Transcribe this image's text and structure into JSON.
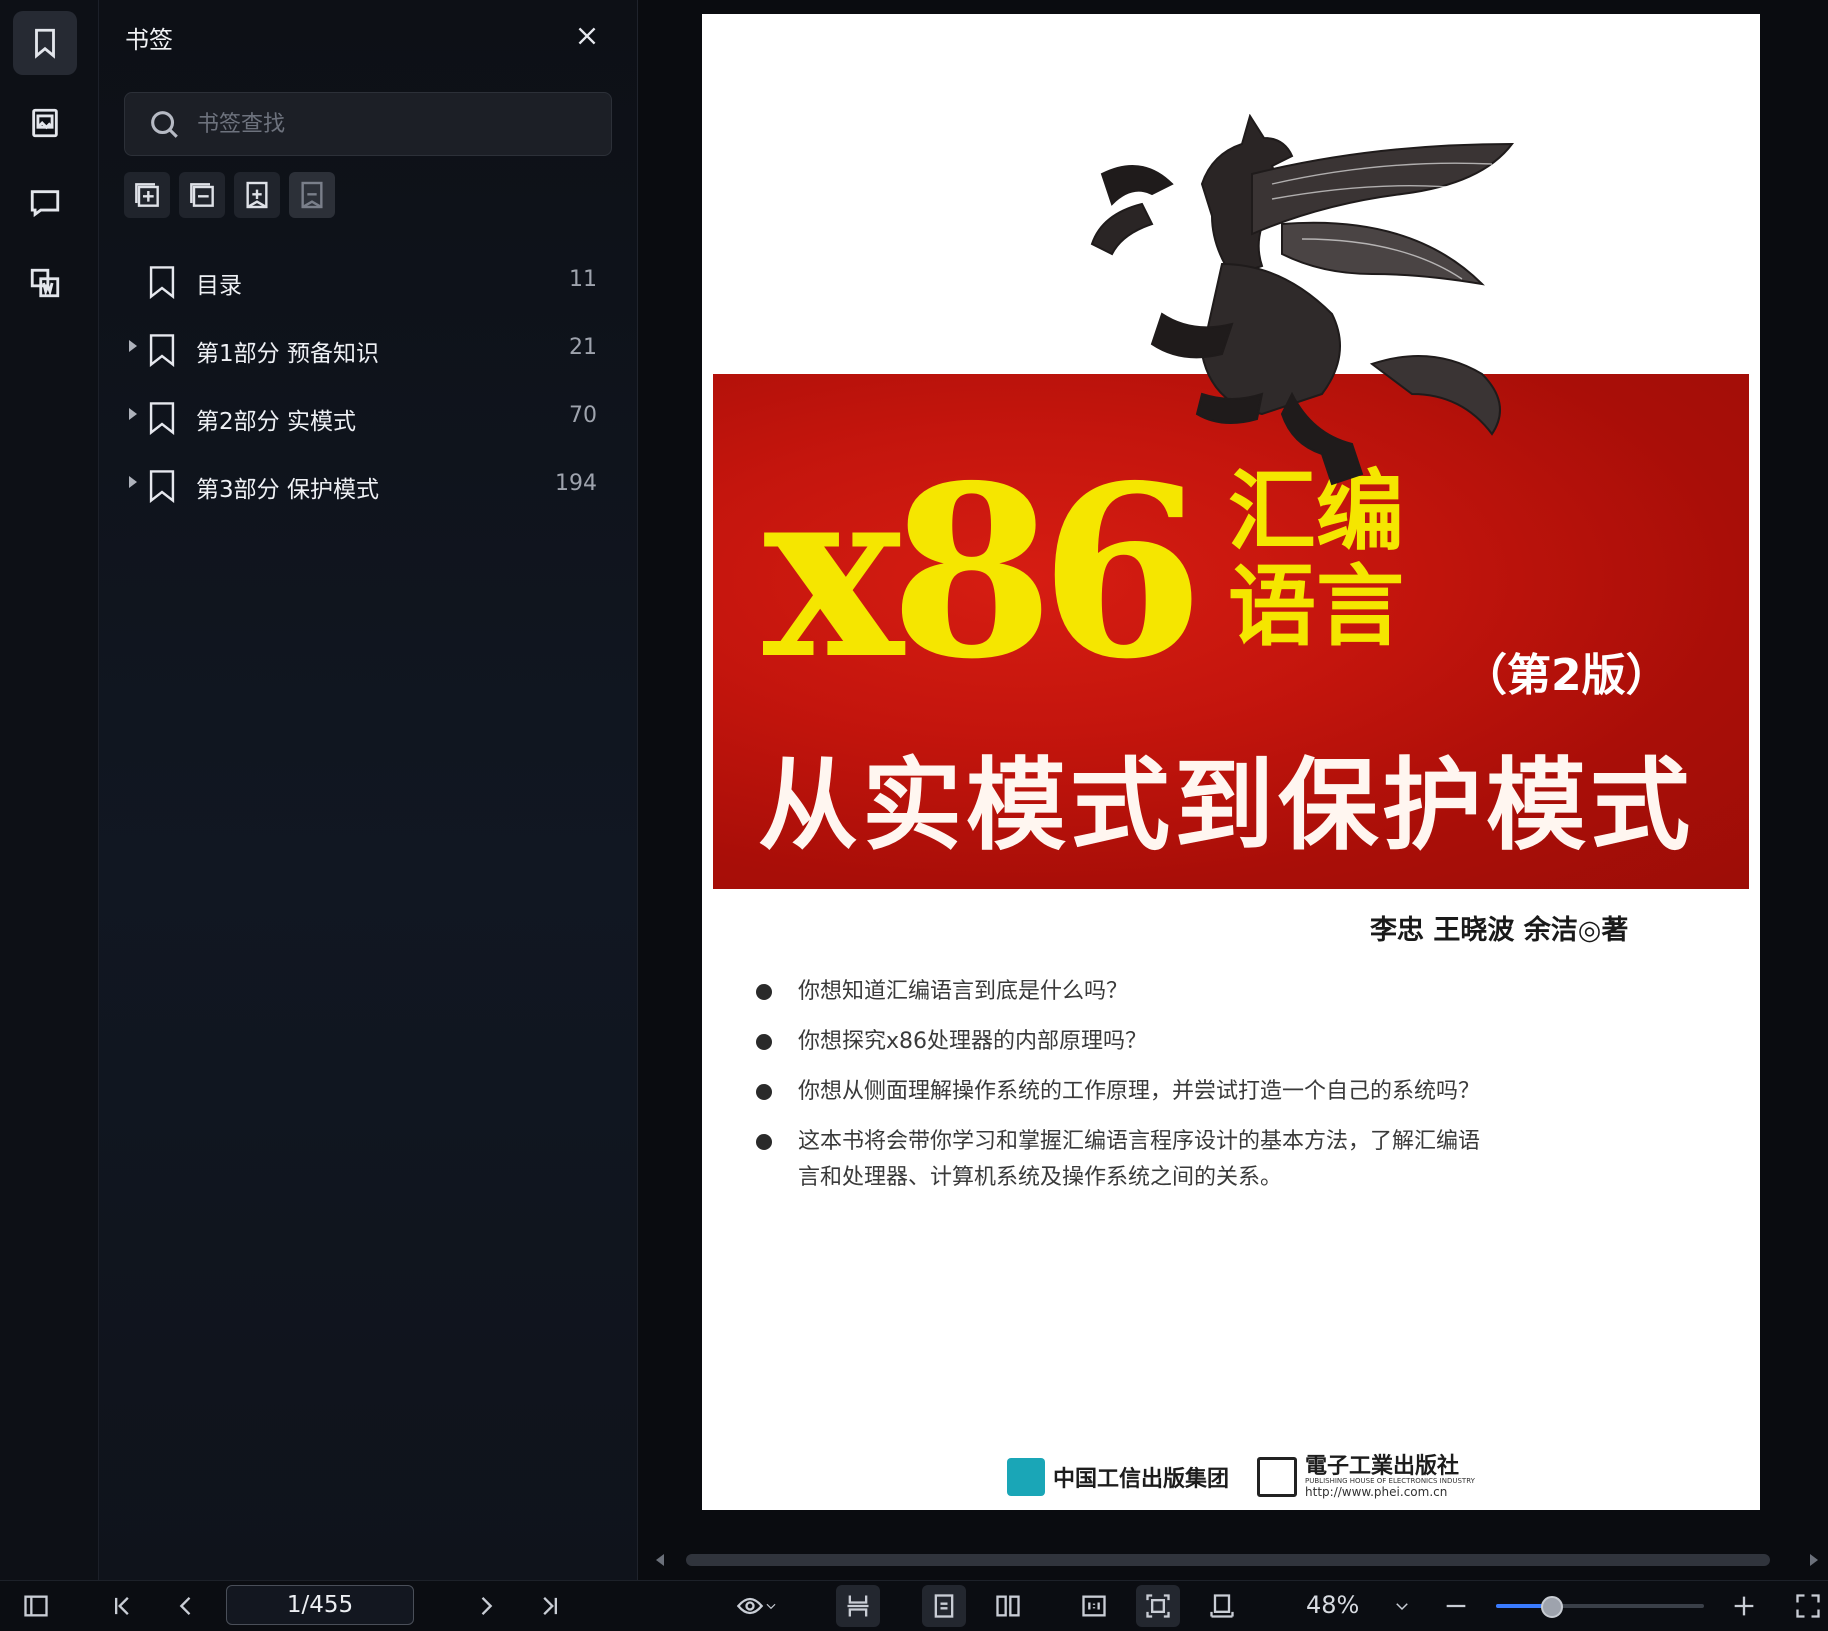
{
  "sidebar_rail": {
    "items": [
      {
        "name": "bookmark",
        "active": true
      },
      {
        "name": "thumbnails",
        "active": false
      },
      {
        "name": "comments",
        "active": false
      },
      {
        "name": "word-export",
        "active": false
      }
    ]
  },
  "bookmark_panel": {
    "title": "书签",
    "search_placeholder": "书签查找",
    "tools": [
      "expand-all",
      "collapse-all",
      "add-bookmark",
      "remove-bookmark"
    ],
    "items": [
      {
        "label": "目录",
        "page": "11",
        "expandable": false
      },
      {
        "label": "第1部分 预备知识",
        "page": "21",
        "expandable": true
      },
      {
        "label": "第2部分 实模式",
        "page": "70",
        "expandable": true
      },
      {
        "label": "第3部分 保护模式",
        "page": "194",
        "expandable": true
      }
    ]
  },
  "cover": {
    "title_main": "x86",
    "title_cn_line1": "汇编",
    "title_cn_line2": "语言",
    "edition": "（第2版）",
    "subtitle": "从实模式到保护模式",
    "authors": "李忠  王晓波  余洁◎著",
    "bullets": [
      "你想知道汇编语言到底是什么吗？",
      "你想探究x86处理器的内部原理吗？",
      "你想从侧面理解操作系统的工作原理，并尝试打造一个自己的系统吗？",
      "这本书将会带你学习和掌握汇编语言程序设计的基本方法，了解汇编语言和处理器、计算机系统及操作系统之间的关系。"
    ],
    "publisher1": "中国工信出版集团",
    "publisher2": "電子工業出版社",
    "publisher2_sub": "PUBLISHING HOUSE OF ELECTRONICS INDUSTRY",
    "publisher2_url": "http://www.phei.com.cn"
  },
  "toolbar": {
    "page_indicator": "1/455",
    "zoom": "48%",
    "zoom_level": 0.26
  },
  "colors": {
    "cover_red": "#c4150d",
    "cover_yellow": "#f5e600",
    "accent": "#3a7bff"
  }
}
